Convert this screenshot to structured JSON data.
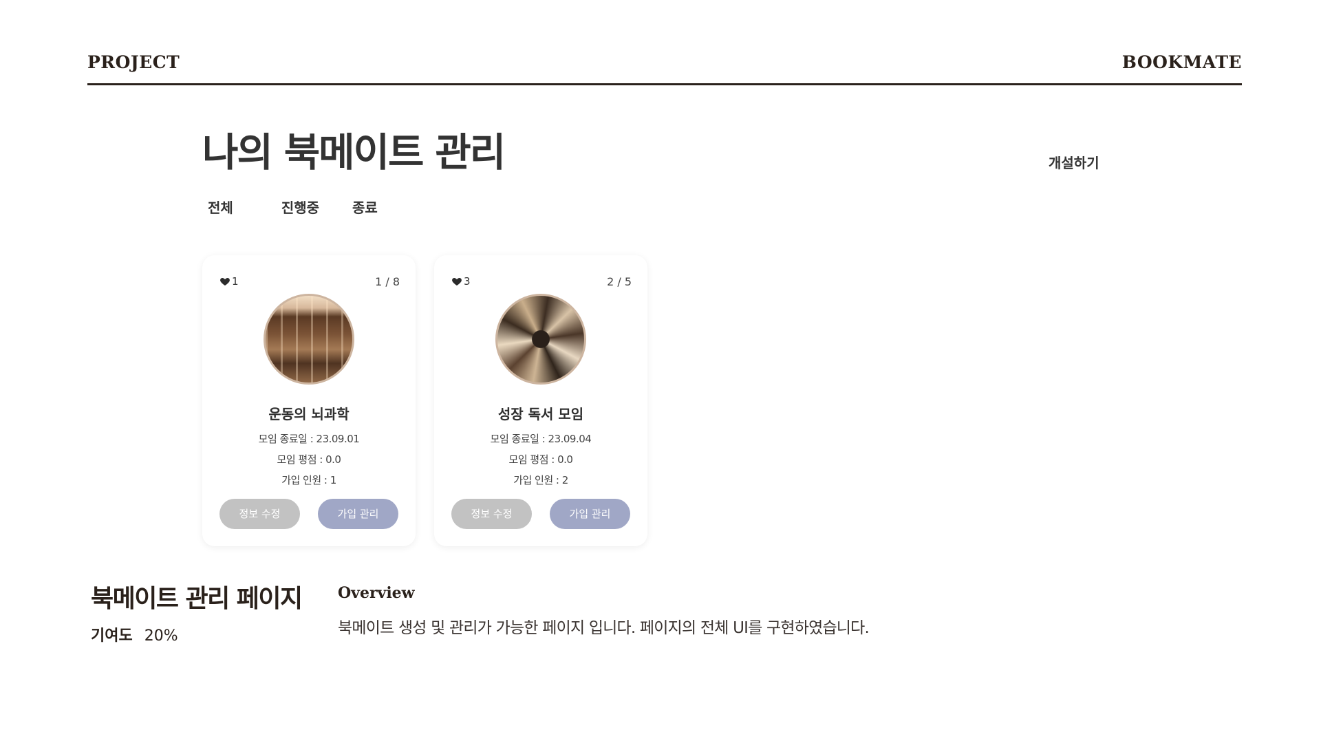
{
  "header": {
    "left": "PROJECT",
    "right": "BOOKMATE"
  },
  "page": {
    "title": "나의 북메이트 관리",
    "create_label": "개설하기"
  },
  "filters": [
    {
      "label": "전체"
    },
    {
      "label": "진행중"
    },
    {
      "label": "종료"
    }
  ],
  "cards": [
    {
      "likes": "1",
      "members_ratio": "1 / 8",
      "title": "운동의 뇌과학",
      "end_date": "모임 종료일 : 23.09.01",
      "rating": "모임 평점 : 0.0",
      "members": "가입 인원 : 1",
      "edit_label": "정보 수정",
      "manage_label": "가입 관리"
    },
    {
      "likes": "3",
      "members_ratio": "2 / 5",
      "title": "성장 독서 모임",
      "end_date": "모임 종료일 : 23.09.04",
      "rating": "모임 평점 : 0.0",
      "members": "가입 인원 : 2",
      "edit_label": "정보 수정",
      "manage_label": "가입 관리"
    }
  ],
  "footer": {
    "title": "북메이트 관리 페이지",
    "contribution_label": "기여도",
    "contribution_value": "20%",
    "overview_heading": "Overview",
    "overview_text": "북메이트 생성 및 관리가 가능한 페이지 입니다.  페이지의 전체 UI를 구현하였습니다."
  },
  "colors": {
    "edit_button": "#c2c2c2",
    "manage_button": "#a0a7c6",
    "header_rule": "#2a211b"
  }
}
